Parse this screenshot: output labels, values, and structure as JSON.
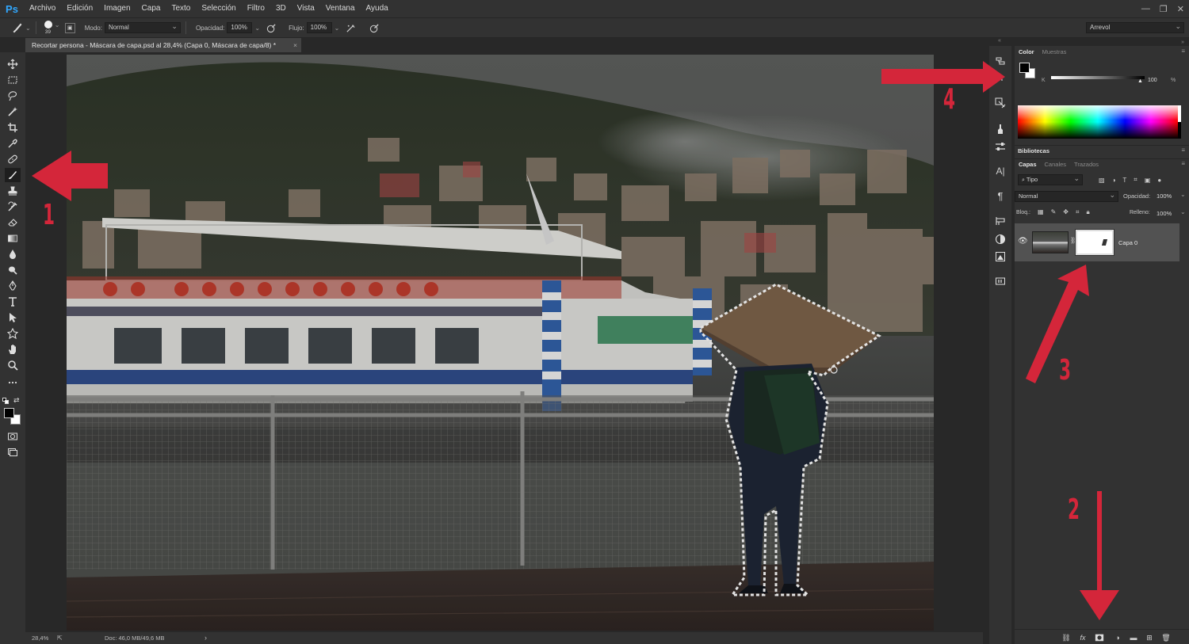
{
  "app": {
    "logo": "Ps",
    "menu": [
      "Archivo",
      "Edición",
      "Imagen",
      "Capa",
      "Texto",
      "Selección",
      "Filtro",
      "3D",
      "Vista",
      "Ventana",
      "Ayuda"
    ],
    "window_controls": [
      "—",
      "❐",
      "✕"
    ]
  },
  "options_bar": {
    "brush_size": "39",
    "mode_label": "Modo:",
    "mode_value": "Normal",
    "opacity_label": "Opacidad:",
    "opacity_value": "100%",
    "flow_label": "Flujo:",
    "flow_value": "100%",
    "workspace_value": "Arrevol"
  },
  "document": {
    "tab_title": "Recortar persona - Máscara de capa.psd al 28,4% (Capa 0, Máscara de capa/8) *",
    "close_glyph": "×"
  },
  "status_bar": {
    "zoom": "28,4%",
    "doc_info": "Doc: 46,0 MB/49,6 MB",
    "arrow": "›"
  },
  "color_panel": {
    "tabs": [
      "Color",
      "Muestras"
    ],
    "channel_label": "K",
    "value": "100",
    "unit": "%",
    "fg_color": "#000000",
    "bg_color": "#ffffff"
  },
  "libraries_panel": {
    "title": "Bibliotecas"
  },
  "layers_panel": {
    "tabs": [
      "Capas",
      "Canales",
      "Trazados"
    ],
    "filter_value": "Tipo",
    "blend_mode": "Normal",
    "opacity_label": "Opacidad:",
    "opacity_value": "100%",
    "lock_label": "Bloq.:",
    "fill_label": "Relleno:",
    "fill_value": "100%",
    "layers": [
      {
        "name": "Capa 0",
        "visible": true,
        "has_mask": true
      }
    ],
    "footer_icons": [
      "link-icon",
      "fx-icon",
      "add-mask-icon",
      "adjustment-icon",
      "folder-icon",
      "new-layer-icon",
      "trash-icon"
    ]
  },
  "annotations": {
    "color": "#d4263a",
    "labels": [
      "1",
      "2",
      "3",
      "4"
    ]
  }
}
